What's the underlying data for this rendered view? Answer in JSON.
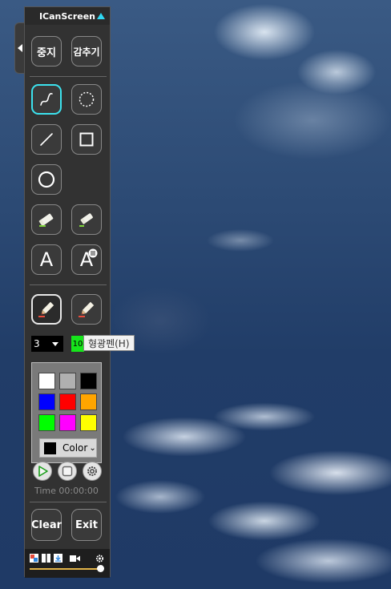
{
  "app": {
    "title": "ICanScreen"
  },
  "top_buttons": {
    "stop_label": "중지",
    "hide_label": "감추기"
  },
  "tools": {
    "text_a": "A",
    "text_a2": "A"
  },
  "size": {
    "value": "3"
  },
  "green": {
    "value": "10"
  },
  "tooltip": {
    "text": "형광펜(H)"
  },
  "palette": {
    "swatches": [
      "#FFFFFF",
      "#B0B0B0",
      "#000000",
      "#0000FF",
      "#FF0000",
      "#FFA500",
      "#00FF00",
      "#FF00FF",
      "#FFFF00"
    ],
    "color_label": "Color",
    "color_chevron": "⌄"
  },
  "timer": {
    "text": "Time 00:00:00"
  },
  "bottom_buttons": {
    "clear_label": "Clear",
    "exit_label": "Exit"
  },
  "colors": {
    "accent": "#3CE2EE",
    "highlighter": "#16E51B",
    "panel": "#323232"
  }
}
